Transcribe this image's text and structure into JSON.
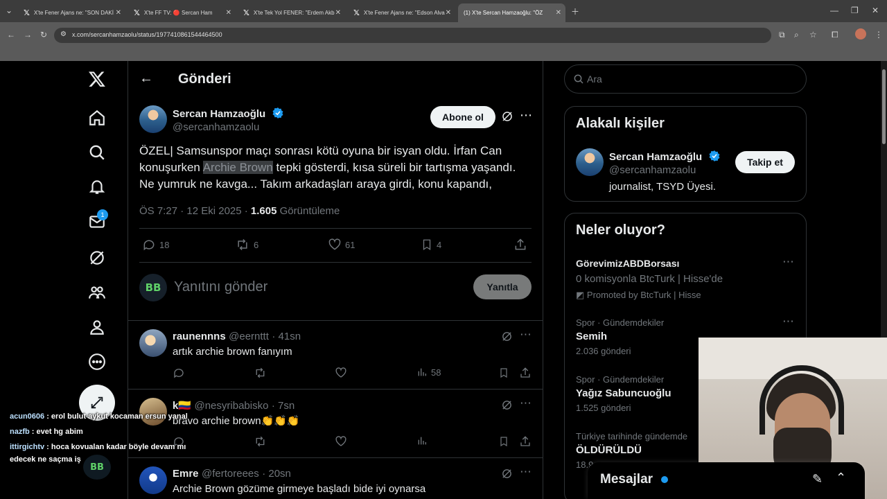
{
  "browser": {
    "tabs": [
      {
        "title": "X'te Fener Ajans ne: \"SON DAKİ"
      },
      {
        "title": "X'te FF TV: 🔴 Sercan Ham"
      },
      {
        "title": "X'te Tek Yol FENER: \"Erdem Akb"
      },
      {
        "title": "X'te Fener Ajans ne: \"Edson Alva"
      },
      {
        "title": "(1) X'te Sercan Hamzaoğlu: \"ÖZ"
      }
    ],
    "url": "x.com/sercanhamzaolu/status/1977410861544464500"
  },
  "nav": {
    "messages_badge": "1",
    "items": [
      "x-logo",
      "home",
      "explore",
      "notifications",
      "messages",
      "grok",
      "communities",
      "profile",
      "more"
    ]
  },
  "header": {
    "title": "Gönderi"
  },
  "post": {
    "author_name": "Sercan Hamzaoğlu",
    "author_handle": "@sercanhamzaolu",
    "follow_label": "Abone ol",
    "text_before": "ÖZEL| Samsunspor maçı sonrası kötü oyuna bir isyan oldu. İrfan Can konuşurken ",
    "text_highlight": "Archie Brown",
    "text_after": " tepki gösterdi, kısa süreli bir tartışma yaşandı. Ne yumruk ne kavga... Takım arkadaşları araya girdi, konu kapandı,",
    "time": "ÖS 7:27 · 12 Eki 2025 · ",
    "views": "1.605",
    "views_label": " Görüntüleme",
    "replies": "18",
    "reposts": "6",
    "likes": "61",
    "bookmarks": "4"
  },
  "composer": {
    "placeholder": "Yanıtını gönder",
    "reply_label": "Yanıtla",
    "avatar_text": "BB"
  },
  "replies": [
    {
      "name": "raunennns",
      "handle": "@eernttt",
      "time": "· 41sn",
      "text": "artık archie brown fanıyım",
      "views": "58"
    },
    {
      "name": "k🇨🇴",
      "handle": "@nesyribabisko",
      "time": "· 7sn",
      "text": "bravo archie brown👏👏👏",
      "views": ""
    },
    {
      "name": "Emre",
      "handle": "@fertoreees",
      "time": "· 20sn",
      "text": "Archie Brown gözüme girmeye başladı bide iyi oynarsa",
      "views": ""
    }
  ],
  "search": {
    "placeholder": "Ara"
  },
  "related": {
    "title": "Alakalı kişiler",
    "name": "Sercan Hamzaoğlu",
    "handle": "@sercanhamzaolu",
    "bio": "journalist, TSYD Üyesi.",
    "follow_label": "Takip et"
  },
  "trends": {
    "title": "Neler oluyor?",
    "items": [
      {
        "name": "GörevimizABDBorsası",
        "desc": "0 komisyonla BtcTurk | Hisse'de",
        "promo": "Promoted by BtcTurk | Hisse"
      },
      {
        "category": "Spor · Gündemdekiler",
        "name": "Semih",
        "count": "2.036 gönderi"
      },
      {
        "category": "Spor · Gündemdekiler",
        "name": "Yağız Sabuncuoğlu",
        "count": "1.525 gönderi"
      },
      {
        "category": "Türkiye tarihinde gündemde",
        "name": "ÖLDÜRÜLDÜ",
        "count": "18.9"
      }
    ]
  },
  "messages": {
    "title": "Mesajlar"
  },
  "chat": [
    {
      "user": "acun0606",
      "text": " : erol bulut aykut kocaman ersun yanal"
    },
    {
      "user": "nazfb",
      "text": " : evet hg abim"
    },
    {
      "user": "ittirgichtv",
      "text": " : hoca kovualan kadar böyle devam mı"
    },
    {
      "user": "",
      "text": "edecek ne saçma iş"
    }
  ],
  "colors": {
    "accent": "#1d9bf0",
    "bg": "#000000",
    "border": "#2f3336",
    "muted": "#71767b"
  }
}
